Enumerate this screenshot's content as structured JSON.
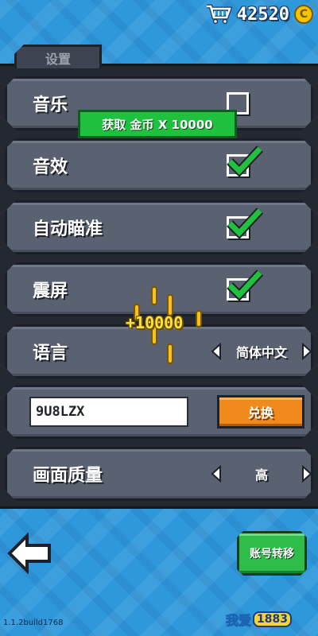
{
  "header": {
    "coins": "42520",
    "coin_symbol": "C"
  },
  "settings": {
    "tab_title": "设置",
    "rows": [
      {
        "label": "音乐",
        "checked": false
      },
      {
        "label": "音效",
        "checked": true
      },
      {
        "label": "自动瞄准",
        "checked": true
      },
      {
        "label": "震屏",
        "checked": true
      }
    ],
    "language": {
      "label": "语言",
      "value": "简体中文"
    },
    "redeem": {
      "code": "9U8LZX",
      "button": "兑换"
    },
    "quality": {
      "label": "画面质量",
      "value": "高"
    }
  },
  "overlay": {
    "toast": "获取 金币 X 10000",
    "reward": "+10000"
  },
  "footer": {
    "transfer_button": "账号转移",
    "version": "1.1.2build1768",
    "watermark_text": "我爱",
    "watermark_num": "1883"
  },
  "colors": {
    "background": "#2f98db",
    "panel": "#242830",
    "row": "#5a6170",
    "check": "#1fc13e",
    "redeem": "#f08a1c",
    "transfer": "#2fbd4a",
    "coin": "#f5c400"
  }
}
